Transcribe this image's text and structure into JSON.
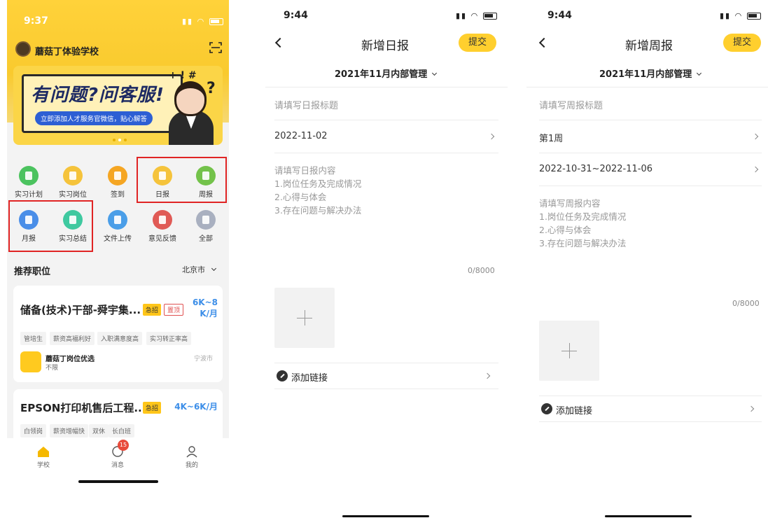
{
  "school_app": {
    "status": {
      "time": "9:37"
    },
    "school_name": "蘑菇丁体验学校",
    "banner": {
      "title": "有问题?问客服!",
      "subtitle": "立即添加人才服务官微信，贴心解答"
    },
    "icons": [
      {
        "label": "实习计划",
        "color": "#4cc35f"
      },
      {
        "label": "实习岗位",
        "color": "#f5c33b"
      },
      {
        "label": "签到",
        "color": "#f5a623"
      },
      {
        "label": "日报",
        "color": "#f5c33b"
      },
      {
        "label": "周报",
        "color": "#73c24a"
      },
      {
        "label": "月报",
        "color": "#4a8ee8"
      },
      {
        "label": "实习总结",
        "color": "#3fc9a0"
      },
      {
        "label": "文件上传",
        "color": "#4a9ee8"
      },
      {
        "label": "意见反馈",
        "color": "#e05a55"
      },
      {
        "label": "全部",
        "color": "#a9b0c0"
      }
    ],
    "recommend": {
      "title": "推荐职位",
      "city": "北京市"
    },
    "jobs": [
      {
        "title": "储备(技术)干部-舜宇集...",
        "urgent": "急招",
        "top": "置顶",
        "salary_line1": "6K~8",
        "salary_line2": "K/月",
        "tags": [
          "管培生",
          "薪资高福利好",
          "入职满意度高",
          "实习转正率高"
        ],
        "company": "蘑菇丁岗位优选",
        "company_sub": "不限",
        "location": "宁波市"
      },
      {
        "title": "EPSON打印机售后工程...",
        "urgent": "急招",
        "salary": "4K~6K/月",
        "tags": [
          "白领岗",
          "薪资增幅快",
          "双休",
          "长白班"
        ]
      }
    ],
    "tabbar": [
      {
        "label": "学校",
        "active": true
      },
      {
        "label": "消息",
        "badge": "15"
      },
      {
        "label": "我的"
      }
    ]
  },
  "daily_report": {
    "status": {
      "time": "9:44"
    },
    "title": "新增日报",
    "submit": "提交",
    "period": "2021年11月内部管理",
    "title_placeholder": "请填写日报标题",
    "date": "2022-11-02",
    "content_hint": [
      "请填写日报内容",
      "1.岗位任务及完成情况",
      "2.心得与体会",
      "3.存在问题与解决办法"
    ],
    "counter": "0/8000",
    "add_link": "添加链接"
  },
  "weekly_report": {
    "status": {
      "time": "9:44"
    },
    "title": "新增周报",
    "submit": "提交",
    "period": "2021年11月内部管理",
    "title_placeholder": "请填写周报标题",
    "week": "第1周",
    "date_range": "2022-10-31~2022-11-06",
    "content_hint": [
      "请填写周报内容",
      "1.岗位任务及完成情况",
      "2.心得与体会",
      "3.存在问题与解决办法"
    ],
    "counter": "0/8000",
    "add_link": "添加链接"
  }
}
